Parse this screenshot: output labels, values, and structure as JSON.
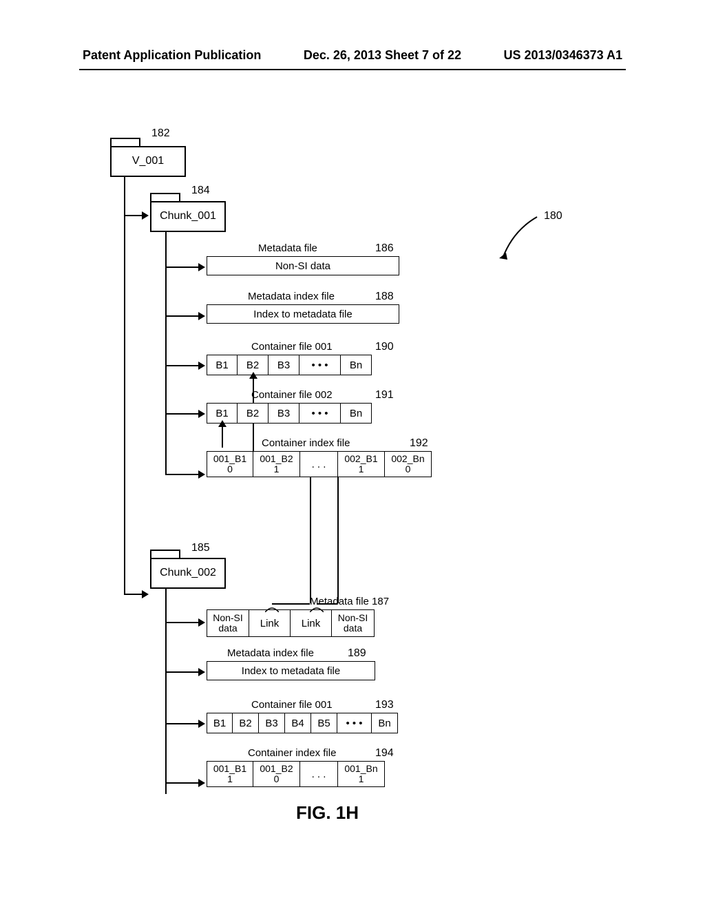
{
  "header": {
    "left": "Patent Application Publication",
    "center": "Dec. 26, 2013  Sheet 7 of 22",
    "right": "US 2013/0346373 A1"
  },
  "figure_label": "FIG. 1H",
  "refs": {
    "r180": "180",
    "r182": "182",
    "r184": "184",
    "r185": "185",
    "r186": "186",
    "r187": "187",
    "r188": "188",
    "r189": "189",
    "r190": "190",
    "r191": "191",
    "r192": "192",
    "r193": "193",
    "r194": "194"
  },
  "folders": {
    "v001": "V_001",
    "chunk001": "Chunk_001",
    "chunk002": "Chunk_002"
  },
  "labels": {
    "metadata_file": "Metadata file",
    "non_si_data": "Non-SI data",
    "metadata_index_file": "Metadata index file",
    "index_to_metadata": "Index to metadata file",
    "container_file_001": "Container file 001",
    "container_file_002": "Container file 002",
    "container_index_file": "Container index file",
    "metadata_file_187": "Metadata file  187"
  },
  "blocks": {
    "B1": "B1",
    "B2": "B2",
    "B3": "B3",
    "B4": "B4",
    "B5": "B5",
    "Bn": "Bn",
    "dots": "• • •"
  },
  "index_cells": {
    "c1": {
      "top": "001_B1",
      "bot": "0"
    },
    "c2": {
      "top": "001_B2",
      "bot": "1"
    },
    "c3": {
      "top": "002_B1",
      "bot": "1"
    },
    "c4": {
      "top": "002_Bn",
      "bot": "0"
    },
    "dots": ". . ."
  },
  "meta187": {
    "c1": {
      "top": "Non-SI",
      "bot": "data"
    },
    "c2": "Link",
    "c3": "Link",
    "c4": {
      "top": "Non-SI",
      "bot": "data"
    }
  },
  "index194": {
    "c1": {
      "top": "001_B1",
      "bot": "1"
    },
    "c2": {
      "top": "001_B2",
      "bot": "0"
    },
    "c3": {
      "top": "001_Bn",
      "bot": "1"
    },
    "dots": ". . ."
  },
  "chart_data": {
    "type": "tree",
    "root": "V_001 (182)",
    "overall_ref": "180",
    "children": [
      {
        "name": "Chunk_001 (184)",
        "children": [
          {
            "name": "Metadata file (186)",
            "content": "Non-SI data"
          },
          {
            "name": "Metadata index file (188)",
            "content": "Index to metadata file"
          },
          {
            "name": "Container file 001 (190)",
            "cells": [
              "B1",
              "B2",
              "B3",
              "...",
              "Bn"
            ]
          },
          {
            "name": "Container file 002 (191)",
            "cells": [
              "B1",
              "B2",
              "B3",
              "...",
              "Bn"
            ]
          },
          {
            "name": "Container index file (192)",
            "cells": [
              {
                "id": "001_B1",
                "flag": 0
              },
              {
                "id": "001_B2",
                "flag": 1
              },
              "...",
              {
                "id": "002_B1",
                "flag": 1
              },
              {
                "id": "002_Bn",
                "flag": 0
              }
            ]
          }
        ]
      },
      {
        "name": "Chunk_002 (185)",
        "children": [
          {
            "name": "Metadata file (187)",
            "cells": [
              "Non-SI data",
              "Link",
              "Link",
              "Non-SI data"
            ]
          },
          {
            "name": "Metadata index file (189)",
            "content": "Index to metadata file"
          },
          {
            "name": "Container file 001 (193)",
            "cells": [
              "B1",
              "B2",
              "B3",
              "B4",
              "B5",
              "...",
              "Bn"
            ]
          },
          {
            "name": "Container index file (194)",
            "cells": [
              {
                "id": "001_B1",
                "flag": 1
              },
              {
                "id": "001_B2",
                "flag": 0
              },
              "...",
              {
                "id": "001_Bn",
                "flag": 1
              }
            ]
          }
        ]
      }
    ],
    "cross_links": [
      {
        "from": "Chunk_001 Container file 001 B2",
        "to": "Chunk_001 Container index file 001_B2"
      },
      {
        "from": "Chunk_001 Container file 002 B1",
        "to": "Chunk_001 Container index file 002_Bn (region)"
      },
      {
        "from": "Chunk_002 Metadata file Link cells",
        "to": "Chunk_001 Container index file"
      }
    ]
  }
}
